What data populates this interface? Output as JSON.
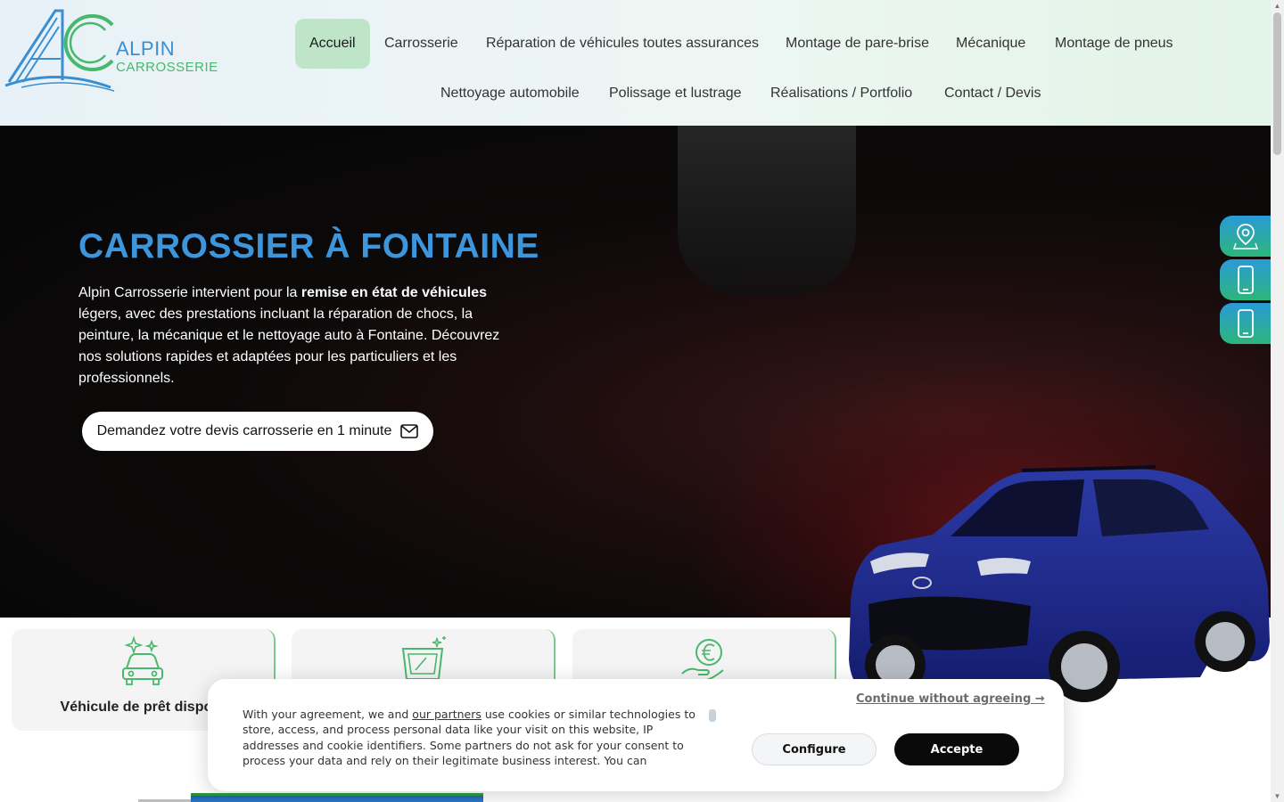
{
  "brand": {
    "line1": "ALPIN",
    "line2": "CARROSSERIE",
    "primary_blue": "#3d96dc",
    "primary_green": "#48b86c"
  },
  "nav": {
    "items": [
      {
        "label": "Accueil",
        "active": true
      },
      {
        "label": "Carrosserie"
      },
      {
        "label": "Réparation de véhicules toutes assurances"
      },
      {
        "label": "Montage de pare-brise"
      },
      {
        "label": "Mécanique"
      },
      {
        "label": "Montage de pneus"
      },
      {
        "label": "Nettoyage automobile"
      },
      {
        "label": "Polissage et lustrage"
      },
      {
        "label": "Réalisations / Portfolio"
      },
      {
        "label": "Contact / Devis"
      }
    ]
  },
  "hero": {
    "title": "CARROSSIER À FONTAINE",
    "text_before": "Alpin Carrosserie intervient pour la ",
    "text_bold": "remise en état de véhicules",
    "text_after": " légers, avec des prestations incluant la réparation de chocs, la peinture, la mécanique et le nettoyage auto à Fontaine. Découvrez nos solutions rapides et adaptées pour les particuliers et les professionnels.",
    "cta_label": "Demandez votre devis carrosserie en 1 minute",
    "cta_icon": "envelope-icon"
  },
  "side_buttons": [
    {
      "icon": "map-pin-icon"
    },
    {
      "icon": "smartphone-icon"
    },
    {
      "icon": "smartphone-icon"
    }
  ],
  "features": [
    {
      "label": "Véhicule de prêt disponi",
      "icon": "car-sparkle-icon"
    },
    {
      "label": "",
      "icon": "windshield-icon"
    },
    {
      "label": "",
      "icon": "euro-hand-icon"
    }
  ],
  "cookie": {
    "text_1": "With your agreement, we and ",
    "link": "our partners",
    "text_2": " use cookies or similar technologies to store, access, and process personal data like your visit on this website, IP addresses and cookie identifiers. Some partners do not ask for your consent to process your data and rely on their legitimate business interest. You can",
    "continue_label": "Continue without agreeing →",
    "configure_label": "Configure",
    "accept_label": "Accepte"
  }
}
